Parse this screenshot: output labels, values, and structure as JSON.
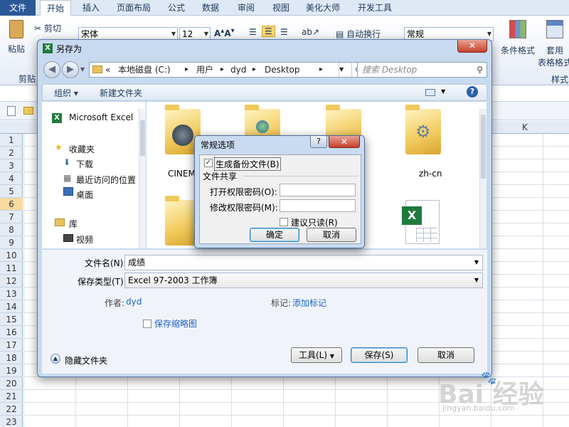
{
  "ribbon": {
    "tabs": [
      "文件",
      "开始",
      "插入",
      "页面布局",
      "公式",
      "数据",
      "审阅",
      "视图",
      "美化大师",
      "开发工具"
    ],
    "paste_label": "粘贴",
    "cut_label": "剪切",
    "clipboard_label": "剪贴",
    "font_name": "宋体",
    "font_size": "12",
    "wrap_text_label": "自动换行",
    "number_format": "常规",
    "cond_format_label": "条件格式",
    "table_format_label": "套用",
    "table_format_label2": "表格格式",
    "styles_group_label": "样式"
  },
  "sheet": {
    "rows": [
      "1",
      "2",
      "3",
      "4",
      "5",
      "6",
      "7",
      "8",
      "9",
      "10",
      "11",
      "12",
      "13",
      "14",
      "15",
      "16",
      "17",
      "18",
      "19",
      "20",
      "21",
      "22",
      "23"
    ],
    "selected_row": "6",
    "visible_column": "K"
  },
  "save_dialog": {
    "title": "另存为",
    "close_glyph": "✕",
    "address": {
      "prefix": "«",
      "crumbs": [
        "本地磁盘 (C:)",
        "用户",
        "dyd",
        "Desktop"
      ]
    },
    "search_placeholder": "搜索 Desktop",
    "toolbar": {
      "organize": "组织 ▾",
      "new_folder": "新建文件夹"
    },
    "nav_items": [
      "Microsoft Excel",
      "收藏夹",
      "下载",
      "最近访问的位置",
      "桌面",
      "库",
      "视频"
    ],
    "files": [
      "CINEMA 4D R1…",
      "zh-cn"
    ],
    "filename_label": "文件名(N):",
    "filename_value": "成绩",
    "filetype_label": "保存类型(T):",
    "filetype_value": "Excel 97-2003 工作簿",
    "author_label": "作者:",
    "author_value": "dyd",
    "tags_label": "标记:",
    "tags_value": "添加标记",
    "thumbnail_label": "保存缩略图",
    "hide_folders_label": "隐藏文件夹",
    "tools_label": "工具(L)",
    "save_label": "保存(S)",
    "cancel_label": "取消"
  },
  "general_dialog": {
    "title": "常规选项",
    "help_glyph": "?",
    "close_glyph": "✕",
    "backup_label": "生成备份文件(B)",
    "backup_checked": true,
    "sharing_label": "文件共享",
    "open_pw_label": "打开权限密码(O):",
    "modify_pw_label": "修改权限密码(M):",
    "readonly_label": "建议只读(R)",
    "ok_label": "确定",
    "cancel_label": "取消"
  },
  "watermark": {
    "brand": "Bai 经验",
    "url": "jingyan.baidu.com"
  }
}
